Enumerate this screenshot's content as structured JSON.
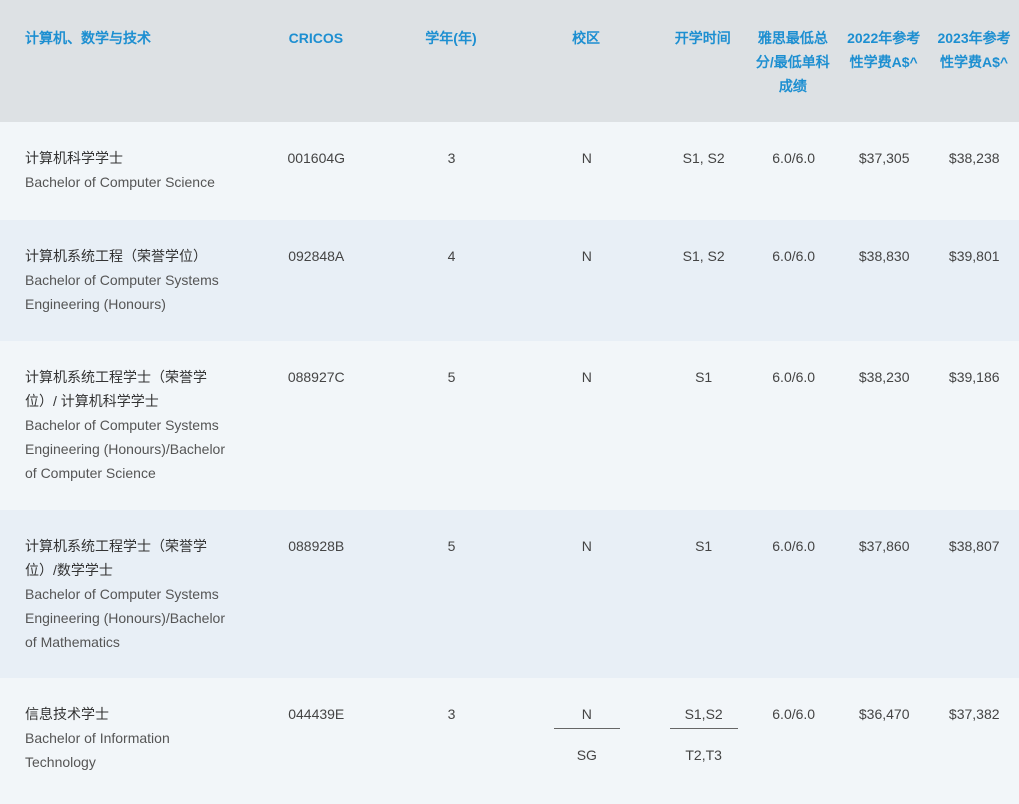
{
  "header": {
    "name": "计算机、数学与技术",
    "cricos": "CRICOS",
    "years": "学年(年)",
    "campus": "校区",
    "intake": "开学时间",
    "ielts": "雅思最低总分/最低单科成绩",
    "fee2022": "2022年参考性学费A$^",
    "fee2023": "2023年参考性学费A$^"
  },
  "rows": [
    {
      "name_zh": "计算机科学学士",
      "name_en": "Bachelor of Computer Science",
      "cricos": "001604G",
      "years": "3",
      "campus": "N",
      "intake": "S1, S2",
      "ielts": "6.0/6.0",
      "fee2022": "$37,305",
      "fee2023": "$38,238"
    },
    {
      "name_zh": "计算机系统工程（荣誉学位）",
      "name_en": "Bachelor of Computer Systems Engineering (Honours)",
      "cricos": "092848A",
      "years": "4",
      "campus": "N",
      "intake": "S1, S2",
      "ielts": "6.0/6.0",
      "fee2022": "$38,830",
      "fee2023": "$39,801"
    },
    {
      "name_zh": "计算机系统工程学士（荣誉学位）/ 计算机科学学士",
      "name_en": "Bachelor of Computer Systems Engineering (Honours)/Bachelor of Computer Science",
      "cricos": "088927C",
      "years": "5",
      "campus": "N",
      "intake": "S1",
      "ielts": "6.0/6.0",
      "fee2022": "$38,230",
      "fee2023": "$39,186"
    },
    {
      "name_zh": "计算机系统工程学士（荣誉学位）/数学学士",
      "name_en": "Bachelor of Computer Systems Engineering (Honours)/Bachelor of Mathematics",
      "cricos": "088928B",
      "years": "5",
      "campus": "N",
      "intake": "S1",
      "ielts": "6.0/6.0",
      "fee2022": "$37,860",
      "fee2023": "$38,807"
    },
    {
      "name_zh": "信息技术学士",
      "name_en": "Bachelor of Information Technology",
      "cricos": "044439E",
      "years": "3",
      "campus": "N",
      "campus_2": "SG",
      "intake": "S1,S2",
      "intake_2": "T2,T3",
      "ielts": "6.0/6.0",
      "fee2022": "$36,470",
      "fee2023": "$37,382"
    }
  ]
}
